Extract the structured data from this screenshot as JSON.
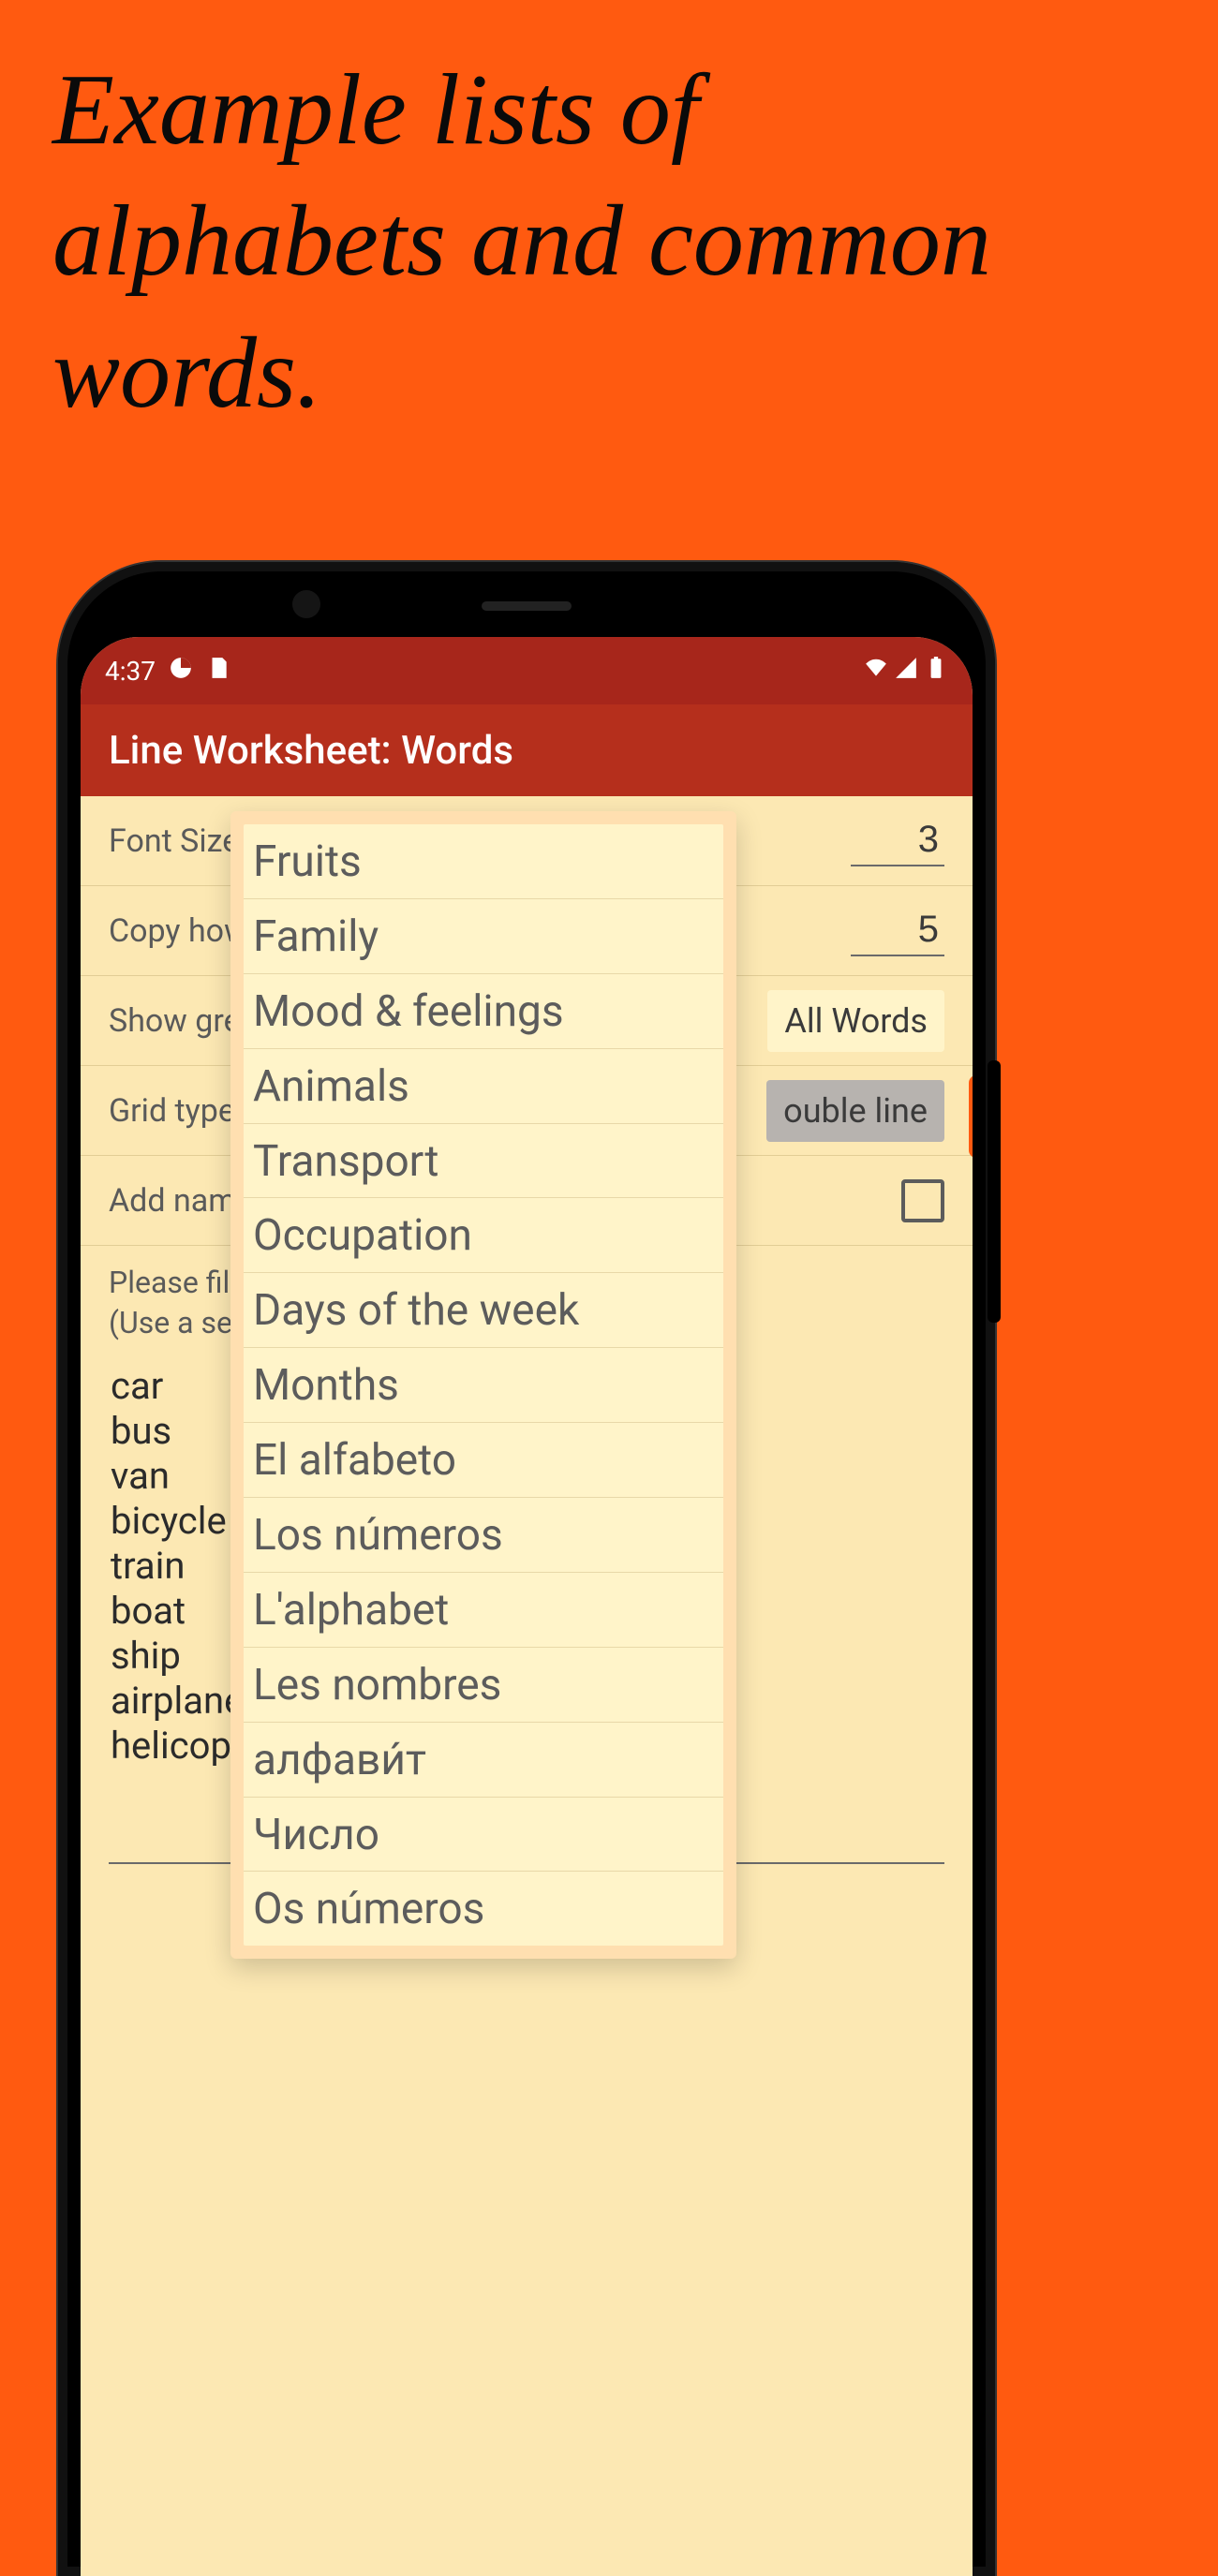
{
  "promo": {
    "heading": "Example lists of alphabets and common words."
  },
  "status": {
    "time": "4:37"
  },
  "appbar": {
    "title": "Line Worksheet: Words"
  },
  "form": {
    "font_size_label": "Font Size",
    "font_size_value": "3",
    "copy_label": "Copy how",
    "copy_value": "5",
    "grey_label": "Show grey",
    "grey_option": "All Words",
    "grid_label": "Grid type",
    "grid_option": "ouble line",
    "add_name_label": "Add name",
    "instruct_line1": "Please fill",
    "instruct_line2": "(Use a sep",
    "words": [
      "car",
      "bus",
      "van",
      "bicycle",
      "train",
      "boat",
      "ship",
      "airplane",
      "helicop"
    ]
  },
  "dropdown": {
    "items": [
      "Fruits",
      "Family",
      "Mood & feelings",
      "Animals",
      "Transport",
      "Occupation",
      "Days of the week",
      "Months",
      "El alfabeto",
      "Los números",
      "L'alphabet",
      "Les nombres",
      "алфави́т",
      "Число",
      "Os números"
    ]
  }
}
